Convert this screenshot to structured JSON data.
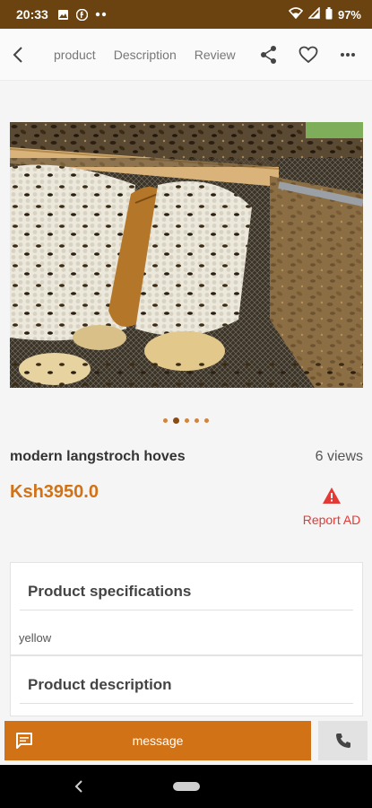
{
  "status_bar": {
    "time": "20:33",
    "battery": "97%",
    "icons": [
      "image-icon",
      "facebook-icon",
      "more-dots-icon",
      "wifi-icon",
      "signal-icon",
      "battery-icon"
    ]
  },
  "header": {
    "tabs": [
      {
        "label": "product"
      },
      {
        "label": "Description"
      },
      {
        "label": "Review"
      }
    ],
    "icons": [
      "back-arrow-icon",
      "share-icon",
      "heart-icon",
      "more-vert-icon"
    ]
  },
  "gallery": {
    "image_subject": "bees on honeycomb in a langstroth hive",
    "page_count": 5,
    "active_index": 1
  },
  "product": {
    "title": "modern langstroch hoves",
    "views": "6 views",
    "price": "Ksh3950.0",
    "report_label": "Report AD"
  },
  "specifications": {
    "heading": "Product specifications",
    "value": "yellow"
  },
  "description": {
    "heading": "Product description"
  },
  "bottom_bar": {
    "message_label": "message"
  },
  "colors": {
    "status_bar": "#6b4311",
    "accent": "#d27216",
    "report": "#e53935"
  }
}
